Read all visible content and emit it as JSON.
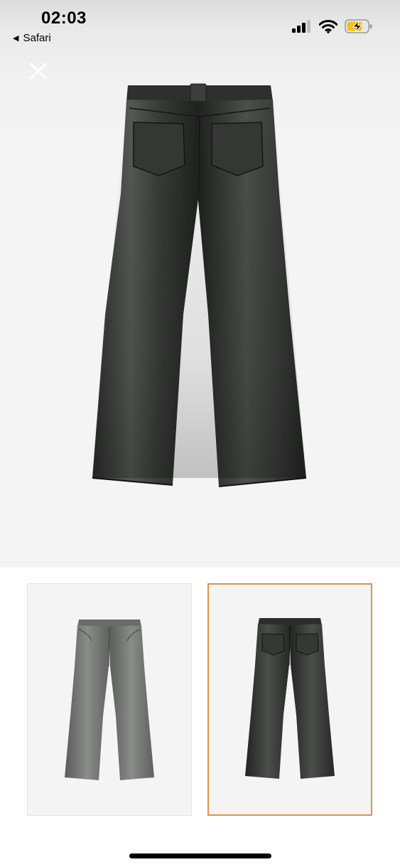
{
  "status_bar": {
    "time": "02:03",
    "back_app_label": "Safari",
    "back_arrow_glyph": "◀",
    "signal_icon": "cellular-signal-icon",
    "wifi_icon": "wifi-icon",
    "battery_icon": "battery-charging-icon",
    "battery_color": "#f4c21a"
  },
  "viewer": {
    "close_icon": "close-icon",
    "main_image": "leather-trousers-back-view",
    "accent_color": "#d8954b"
  },
  "thumbnails": [
    {
      "image": "leather-trousers-front-view",
      "selected": false
    },
    {
      "image": "leather-trousers-back-view",
      "selected": true
    }
  ]
}
